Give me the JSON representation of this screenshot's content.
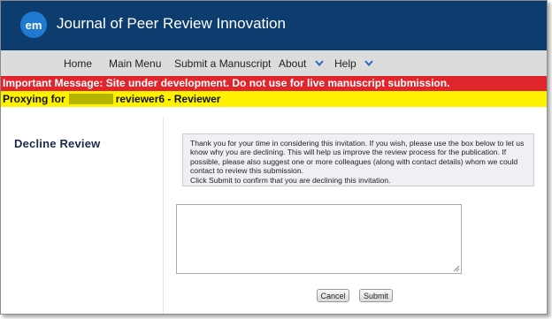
{
  "header": {
    "logo_text": "em",
    "journal_title": "Journal of Peer Review Innovation"
  },
  "nav": {
    "items": [
      {
        "label": "Home"
      },
      {
        "label": "Main Menu"
      },
      {
        "label": "Submit a Manuscript"
      },
      {
        "label": "About",
        "icon": "chevron-down-icon"
      },
      {
        "label": "Help",
        "icon": "chevron-down-icon"
      }
    ]
  },
  "alerts": {
    "important_message": "Important Message: Site under development. Do not use for live manuscript submission.",
    "proxy_prefix": "Proxying for",
    "proxy_user": "reviewer6 - Reviewer"
  },
  "page": {
    "heading": "Decline Review",
    "instructions": [
      "Thank you for your time in considering this invitation. If you wish, please use the box below to let us know why you are declining. This will help us improve the review process for the publication. If possible, please also suggest one or more colleagues (along with contact details) whom we could contact to review this submission.",
      "Click Submit to confirm that you are declining this invitation."
    ],
    "comments_value": ""
  },
  "actions": {
    "cancel_label": "Cancel",
    "submit_label": "Submit"
  },
  "colors": {
    "header_bg": "#0d3c6e",
    "logo_bg": "#1f7ad0",
    "nav_bg": "#dcdcdc",
    "alert_red": "#e0262c",
    "alert_yellow": "#fff200",
    "chevron": "#1f6fc2"
  }
}
